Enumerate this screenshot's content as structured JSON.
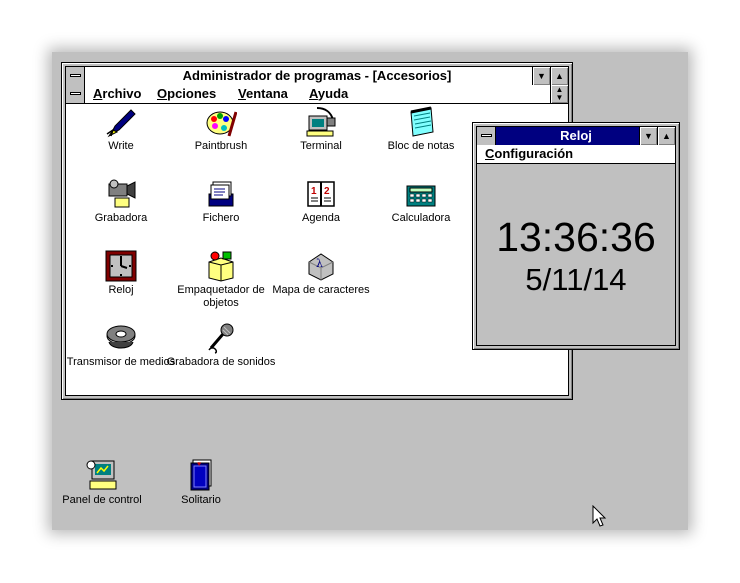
{
  "program_manager": {
    "title": "Administrador de programas - [Accesorios]",
    "menu": [
      {
        "key": "A",
        "rest": "rchivo"
      },
      {
        "key": "O",
        "rest": "pciones"
      },
      {
        "key": "V",
        "rest": "entana"
      },
      {
        "key": "A",
        "rest": "yuda"
      }
    ],
    "icons": [
      {
        "label": "Write",
        "icon": "write-icon"
      },
      {
        "label": "Paintbrush",
        "icon": "paintbrush-icon"
      },
      {
        "label": "Terminal",
        "icon": "terminal-icon"
      },
      {
        "label": "Bloc de notas",
        "icon": "notepad-icon"
      },
      {
        "label": "Grabadora",
        "icon": "recorder-icon"
      },
      {
        "label": "Fichero",
        "icon": "cardfile-icon"
      },
      {
        "label": "Agenda",
        "icon": "calendar-icon"
      },
      {
        "label": "Calculadora",
        "icon": "calculator-icon"
      },
      {
        "label": "Reloj",
        "icon": "clock-icon"
      },
      {
        "label": "Empaquetador de objetos",
        "icon": "packager-icon"
      },
      {
        "label": "Mapa de caracteres",
        "icon": "charmap-icon"
      },
      {
        "label": "Transmisor de medios",
        "icon": "media-player-icon"
      },
      {
        "label": "Grabadora de sonidos",
        "icon": "sound-recorder-icon"
      }
    ]
  },
  "clock": {
    "title": "Reloj",
    "menu_key": "C",
    "menu_rest": "onfiguración",
    "time": "13:36:36",
    "date": "5/11/14"
  },
  "desktop_icons": [
    {
      "label": "Panel de control",
      "icon": "control-panel-icon"
    },
    {
      "label": "Solitario",
      "icon": "solitaire-icon"
    }
  ],
  "colors": {
    "desktop": "#c0c0c0",
    "active_title": "#000080",
    "window_bg": "#ffffff"
  }
}
